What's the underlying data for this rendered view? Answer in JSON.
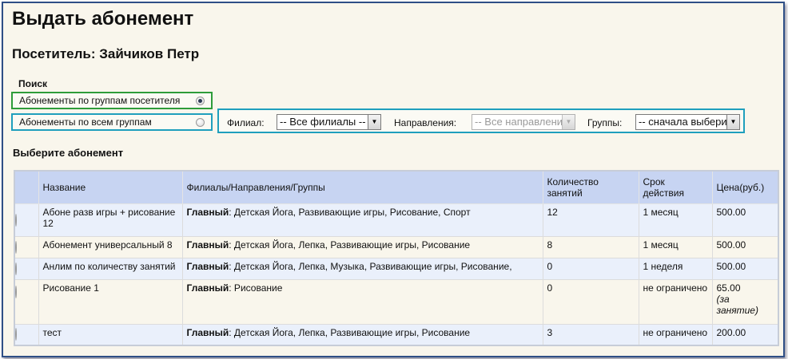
{
  "page": {
    "title": "Выдать абонемент",
    "visitor": "Посетитель: Зайчиков Петр"
  },
  "search": {
    "label": "Поиск",
    "options": [
      {
        "label": "Абонементы по группам посетителя",
        "checked": true
      },
      {
        "label": "Абонементы по всем группам",
        "checked": false
      }
    ]
  },
  "filters": {
    "branch_label": "Филиал:",
    "branch_value": "-- Все филиалы --",
    "direction_label": "Направления:",
    "direction_value": "-- Все направления --",
    "groups_label": "Группы:",
    "groups_value": "-- сначала выберите"
  },
  "choose_label": "Выберите абонемент",
  "table": {
    "headers": [
      "Название",
      "Филиалы/Направления/Группы",
      "Количество занятий",
      "Срок действия",
      "Цена(руб.)"
    ],
    "rows": [
      {
        "name": "Абоне разв игры + рисование 12",
        "branch": "Главный",
        "groups": ": Детская Йога, Развивающие игры, Рисование, Спорт",
        "count": "12",
        "term": "1 месяц",
        "price": "500.00",
        "price_note": ""
      },
      {
        "name": "Абонемент универсальный 8",
        "branch": "Главный",
        "groups": ": Детская Йога, Лепка, Развивающие игры, Рисование",
        "count": "8",
        "term": "1 месяц",
        "price": "500.00",
        "price_note": ""
      },
      {
        "name": "Анлим по количеству занятий",
        "branch": "Главный",
        "groups": ": Детская Йога, Лепка, Музыка, Развивающие игры, Рисование,",
        "count": "0",
        "term": "1 неделя",
        "price": "500.00",
        "price_note": ""
      },
      {
        "name": "Рисование 1",
        "branch": "Главный",
        "groups": ": Рисование",
        "count": "0",
        "term": "не ограничено",
        "price": "65.00",
        "price_note": "(за занятие)"
      },
      {
        "name": "тест",
        "branch": "Главный",
        "groups": ": Детская Йога, Лепка, Развивающие игры, Рисование",
        "count": "3",
        "term": "не ограничено",
        "price": "200.00",
        "price_note": ""
      }
    ]
  },
  "colors": {
    "frame_border": "#2f4f86",
    "background": "#f9f6ec",
    "header_bg": "#c7d4f2",
    "row_blue": "#eaf0fb",
    "green_outline": "#2e9c3a",
    "cyan_outline": "#1f9fbd"
  },
  "icons": {
    "radio": "radio-icon",
    "dropdown": "chevron-down-icon"
  }
}
